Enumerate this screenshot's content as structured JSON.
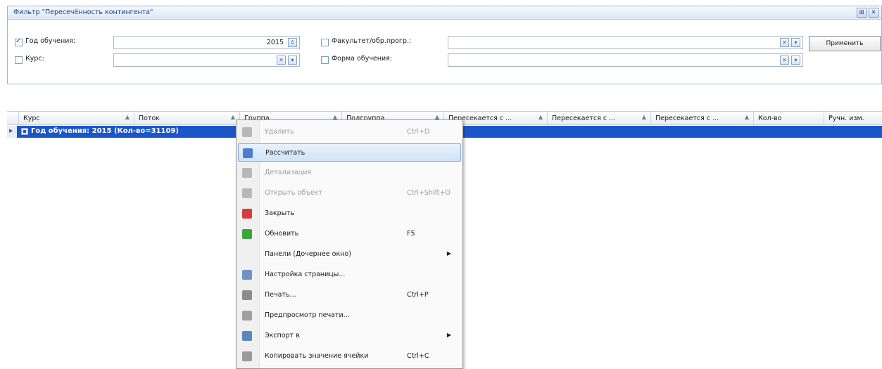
{
  "filter": {
    "title": "Фильтр \"Пересечённость контингента\"",
    "title_buttons": [
      "⊞",
      "✕"
    ],
    "year_label": "Год обучения:",
    "year_checked": true,
    "year_value": "2015",
    "course_label": "Курс:",
    "course_checked": false,
    "course_value": "",
    "faculty_label": "Факультет/обр.прогр.:",
    "faculty_checked": false,
    "faculty_value": "",
    "form_label": "Форма обучения:",
    "form_checked": false,
    "form_value": "",
    "clear_glyph": "✕",
    "dropdown_glyph": "▾",
    "spin_glyph": "⇕",
    "apply_label": "Применить"
  },
  "grid": {
    "columns": [
      {
        "label": "Курс",
        "sort": "▲"
      },
      {
        "label": "Поток",
        "sort": "▲"
      },
      {
        "label": "Группа",
        "sort": "▲"
      },
      {
        "label": "Подгруппа",
        "sort": "▲"
      },
      {
        "label": "Пересекается с ...",
        "sort": "▲"
      },
      {
        "label": "Пересекается с ...",
        "sort": "▲"
      },
      {
        "label": "Пересекается с ...",
        "sort": "▲"
      },
      {
        "label": "Кол-во",
        "sort": ""
      },
      {
        "label": "Ручн. изм.",
        "sort": ""
      }
    ],
    "group_row": "Год обучения: 2015 (Кол-во=31109)"
  },
  "context_menu": {
    "items": [
      {
        "label": "Удалить",
        "shortcut": "Ctrl+D",
        "icon": "delete-icon",
        "icon_color": "#b8b8b8",
        "disabled": true
      },
      {
        "label": "Рассчитать",
        "shortcut": "",
        "icon": "calculate-icon",
        "icon_color": "#4a7fd0",
        "selected": true
      },
      {
        "label": "Детализация",
        "shortcut": "",
        "icon": "details-icon",
        "icon_color": "#b8b8b8",
        "disabled": true
      },
      {
        "label": "Открыть объект",
        "shortcut": "Ctrl+Shift+O",
        "icon": "open-object-icon",
        "icon_color": "#b8b8b8",
        "disabled": true
      },
      {
        "label": "Закрыть",
        "shortcut": "",
        "icon": "close-icon",
        "icon_color": "#d83a3a"
      },
      {
        "label": "Обновить",
        "shortcut": "F5",
        "icon": "refresh-icon",
        "icon_color": "#3aa53a"
      },
      {
        "label": "Панели (Дочернее окно)",
        "shortcut": "",
        "icon": "",
        "icon_color": "",
        "submenu": true
      },
      {
        "label": "Настройка страницы...",
        "shortcut": "",
        "icon": "page-setup-icon",
        "icon_color": "#6f93c4"
      },
      {
        "label": "Печать...",
        "shortcut": "Ctrl+P",
        "icon": "print-icon",
        "icon_color": "#8d8d8d"
      },
      {
        "label": "Предпросмотр печати...",
        "shortcut": "",
        "icon": "print-preview-icon",
        "icon_color": "#a0a0a0"
      },
      {
        "label": "Экспорт в",
        "shortcut": "",
        "icon": "export-icon",
        "icon_color": "#5b86c0",
        "submenu": true
      },
      {
        "label": "Копировать значение ячейки",
        "shortcut": "Ctrl+C",
        "icon": "copy-icon",
        "icon_color": "#9a9a9a"
      }
    ],
    "submenu_glyph": "▶"
  }
}
